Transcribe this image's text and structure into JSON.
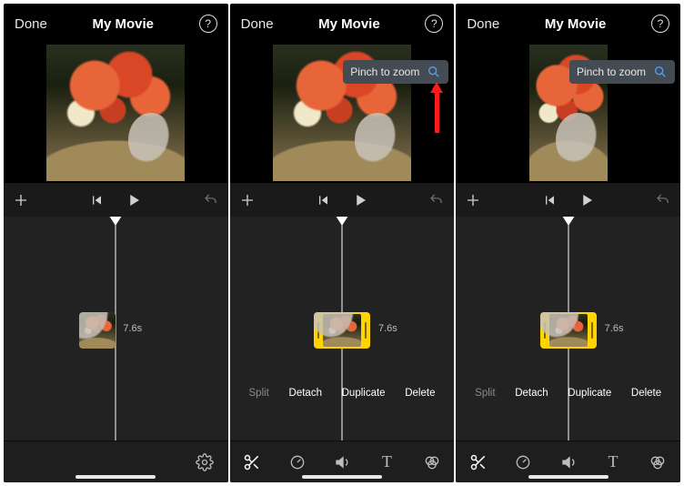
{
  "header": {
    "done": "Done",
    "title": "My Movie"
  },
  "pinch_label": "Pinch to zoom",
  "clip": {
    "duration": "7.6s"
  },
  "tool_labels": {
    "split": "Split",
    "detach": "Detach",
    "duplicate": "Duplicate",
    "delete": "Delete"
  },
  "icons": {
    "help": "help-icon",
    "add": "plus-icon",
    "skip_back": "skip-back-icon",
    "play": "play-icon",
    "undo": "undo-icon",
    "settings": "gear-icon",
    "magnifier": "magnifier-icon",
    "scissors": "scissors-icon",
    "speed": "speedometer-icon",
    "volume": "volume-icon",
    "titles": "text-icon",
    "filters": "filters-icon"
  }
}
